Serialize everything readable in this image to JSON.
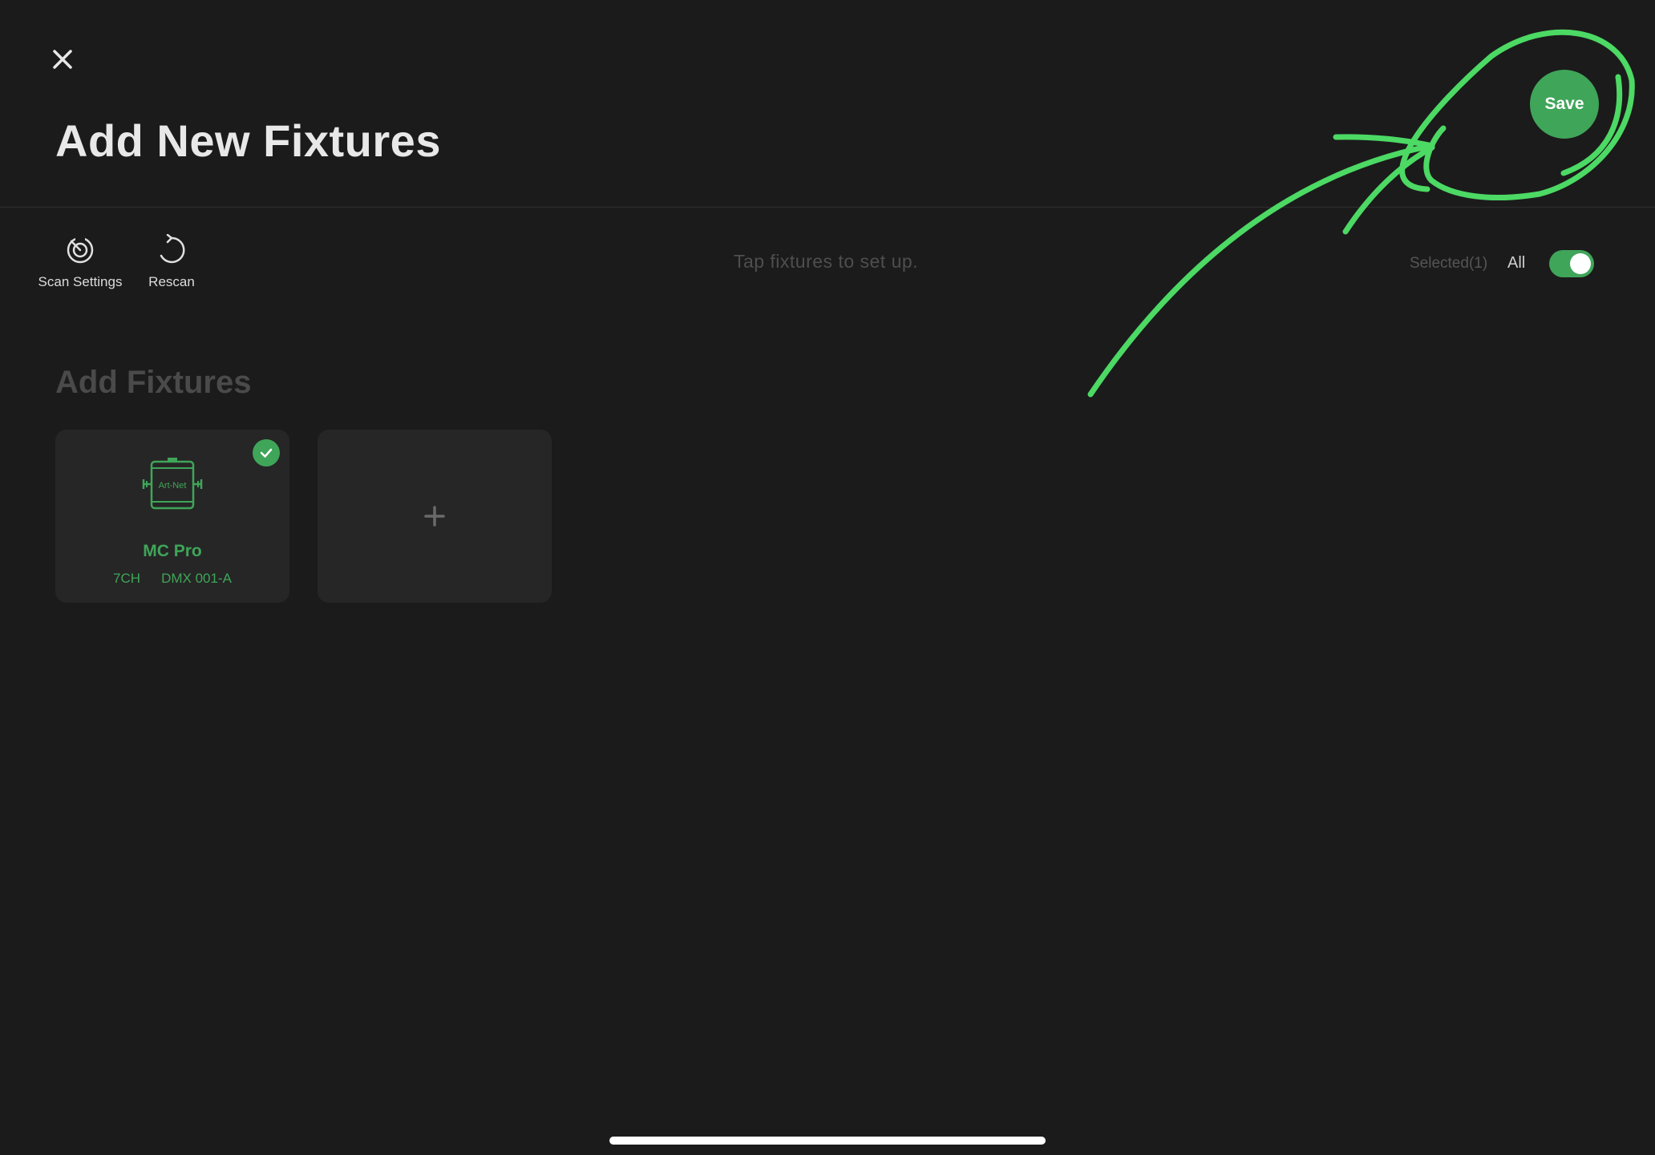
{
  "header": {
    "title": "Add New Fixtures",
    "save_label": "Save"
  },
  "toolbar": {
    "scan_settings_label": "Scan Settings",
    "rescan_label": "Rescan",
    "hint": "Tap fixtures to set up.",
    "selected_count": "Selected(1)",
    "all_label": "All",
    "select_all_on": true
  },
  "section": {
    "title": "Add Fixtures"
  },
  "fixtures": [
    {
      "icon_text": "Art-Net",
      "name": "MC Pro",
      "channels": "7CH",
      "address": "DMX 001-A",
      "selected": true
    }
  ],
  "colors": {
    "background": "#1b1b1b",
    "accent": "#3fa559",
    "annotation": "#4cd964",
    "card": "#262626"
  }
}
